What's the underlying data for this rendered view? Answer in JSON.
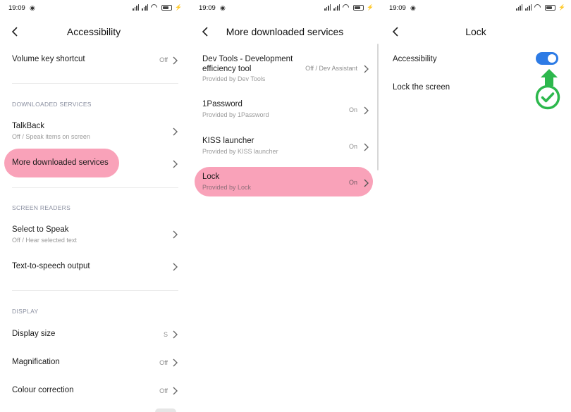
{
  "status": {
    "time": "19:09"
  },
  "screen1": {
    "title": "Accessibility",
    "volume_key": {
      "label": "Volume key shortcut",
      "value": "Off"
    },
    "section_downloaded": "DOWNLOADED SERVICES",
    "talkback": {
      "label": "TalkBack",
      "sub": "Off / Speak items on screen"
    },
    "more_downloaded": {
      "label": "More downloaded services"
    },
    "section_screen_readers": "SCREEN READERS",
    "select_to_speak": {
      "label": "Select to Speak",
      "sub": "Off / Hear selected text"
    },
    "tts": {
      "label": "Text-to-speech output"
    },
    "section_display": "DISPLAY",
    "display_size": {
      "label": "Display size",
      "value": "S"
    },
    "magnification": {
      "label": "Magnification",
      "value": "Off"
    },
    "colour_correction": {
      "label": "Colour correction",
      "value": "Off"
    }
  },
  "screen2": {
    "title": "More downloaded services",
    "items": [
      {
        "label": "Dev Tools - Development efficiency tool",
        "sub": "Provided by Dev Tools",
        "value": "Off / Dev Assistant"
      },
      {
        "label": "1Password",
        "sub": "Provided by 1Password",
        "value": "On"
      },
      {
        "label": "KISS launcher",
        "sub": "Provided by KISS launcher",
        "value": "On"
      },
      {
        "label": "Lock",
        "sub": "Provided by Lock",
        "value": "On"
      }
    ]
  },
  "screen3": {
    "title": "Lock",
    "accessibility": {
      "label": "Accessibility",
      "state": "on"
    },
    "lock_screen": {
      "label": "Lock the screen"
    }
  },
  "colors": {
    "highlight": "#f9a2b9",
    "toggle_on": "#2d7be5",
    "arrow_green": "#2db84d",
    "check_green": "#2db84d"
  },
  "icons": [
    "back-arrow-icon",
    "chevron-right-icon",
    "signal-icon",
    "wifi-icon",
    "battery-icon",
    "alarm-icon",
    "green-arrow-icon",
    "green-checkmark-icon"
  ]
}
